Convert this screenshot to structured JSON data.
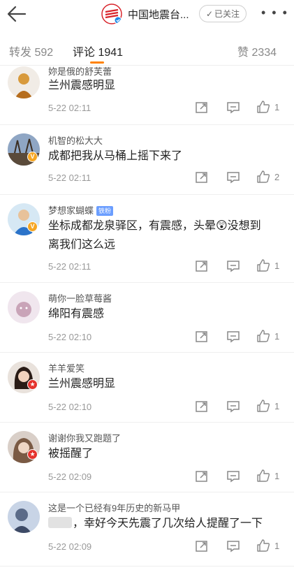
{
  "header": {
    "account_name": "中国地震台...",
    "follow_label": "已关注",
    "more_label": "• • •"
  },
  "tabs": {
    "repost_label": "转发",
    "repost_count": "592",
    "comment_label": "评论",
    "comment_count": "1941",
    "like_label": "赞",
    "like_count": "2334",
    "accent_color": "#ff8200"
  },
  "comments": [
    {
      "user": "妳是俄的舒芙蕾",
      "text": "兰州震感明显",
      "time": "5-22 02:11",
      "likes": "1"
    },
    {
      "user": "机智的松大大",
      "text": "成都把我从马桶上摇下来了",
      "time": "5-22 02:11",
      "likes": "2",
      "verified": "gold"
    },
    {
      "user": "梦想家蝴蝶",
      "badge": "铁粉",
      "text_line1": "坐标成都龙泉驿区，有震感，头晕😲没想到",
      "text_line2": "离我们这么远",
      "time": "5-22 02:11",
      "likes": "1",
      "verified": "gold"
    },
    {
      "user": "萌你一脸草莓酱",
      "text": "绵阳有震感",
      "time": "5-22 02:10",
      "likes": "1"
    },
    {
      "user": "羊羊爱笑",
      "text": "兰州震感明显",
      "time": "5-22 02:10",
      "likes": "1",
      "verified": "red"
    },
    {
      "user": "谢谢你我又跑题了",
      "text": "被摇醒了",
      "time": "5-22 02:09",
      "likes": "1",
      "verified": "red"
    },
    {
      "user": "这是一个已经有9年历史的新马甲",
      "text": "，幸好今天先震了几次给人提醒了一下",
      "time": "5-22 02:09",
      "likes": "1"
    }
  ]
}
